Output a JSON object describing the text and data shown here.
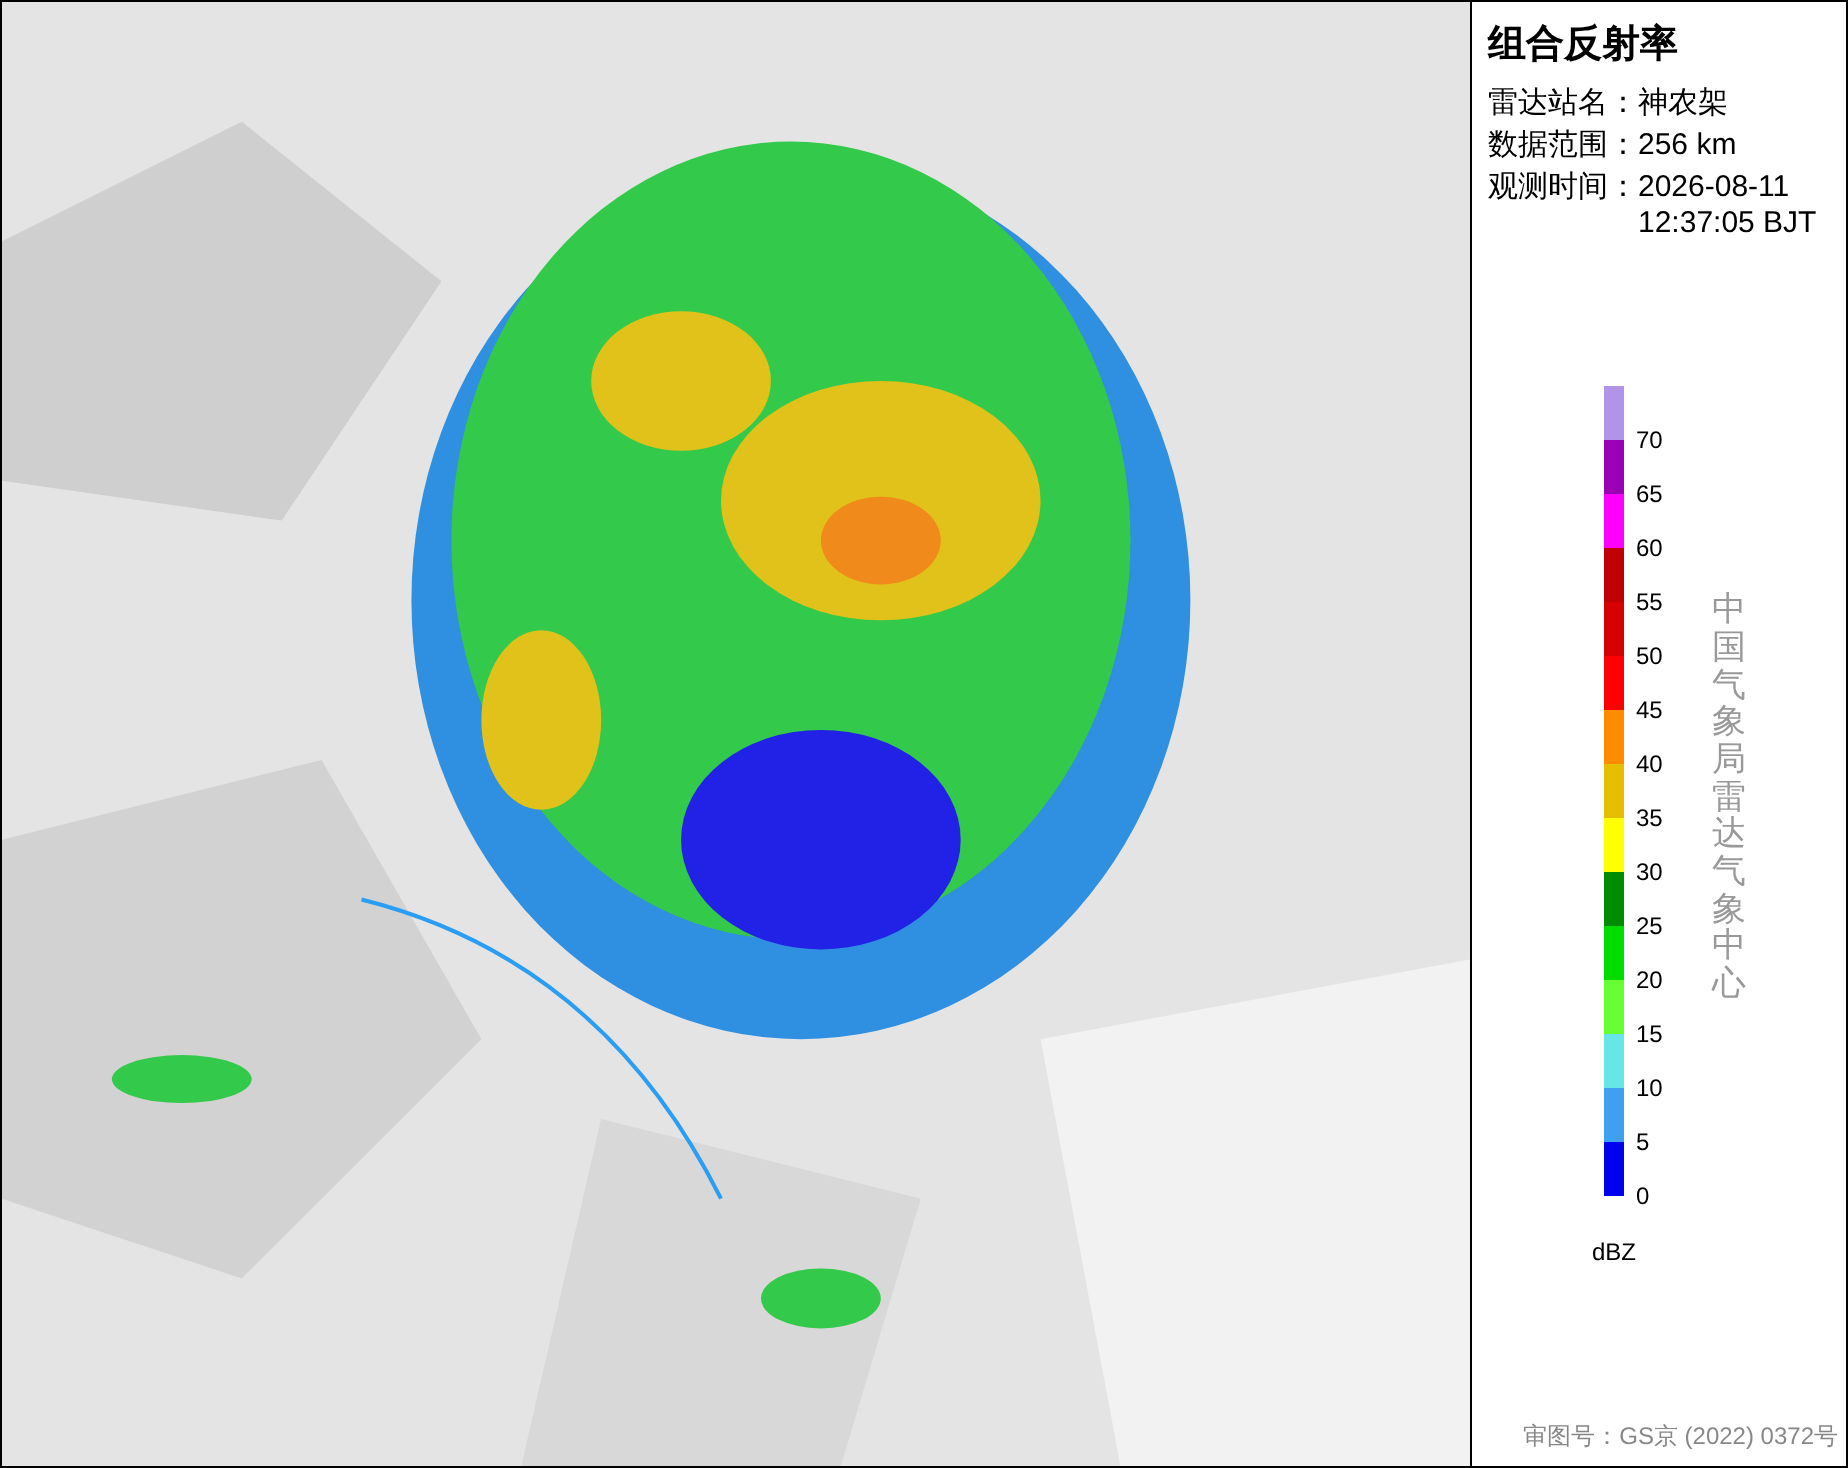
{
  "panel": {
    "title": "组合反射率",
    "info": [
      {
        "label": "雷达站名：",
        "value": "神农架"
      },
      {
        "label": "数据范围：",
        "value": "256 km"
      },
      {
        "label": "观测时间：",
        "value": "2026-08-11\n12:37:05 BJT"
      }
    ],
    "legend": [
      {
        "color": "#b094e8",
        "label": "70"
      },
      {
        "color": "#9a00b4",
        "label": "65"
      },
      {
        "color": "#ff00ff",
        "label": "60"
      },
      {
        "color": "#c00000",
        "label": "55"
      },
      {
        "color": "#d60000",
        "label": "50"
      },
      {
        "color": "#ff0000",
        "label": "45"
      },
      {
        "color": "#ff8c00",
        "label": "40"
      },
      {
        "color": "#e6be00",
        "label": "35"
      },
      {
        "color": "#ffff00",
        "label": "30"
      },
      {
        "color": "#008c00",
        "label": "25"
      },
      {
        "color": "#00dc00",
        "label": "20"
      },
      {
        "color": "#66ff33",
        "label": "15"
      },
      {
        "color": "#66e6e6",
        "label": "10"
      },
      {
        "color": "#40a0f0",
        "label": "5"
      },
      {
        "color": "#0000f0",
        "label": "0"
      }
    ],
    "unit": "dBZ",
    "credit": "中国气象局雷达气象中心",
    "approval": "审图号：GS京 (2022) 0372号"
  }
}
